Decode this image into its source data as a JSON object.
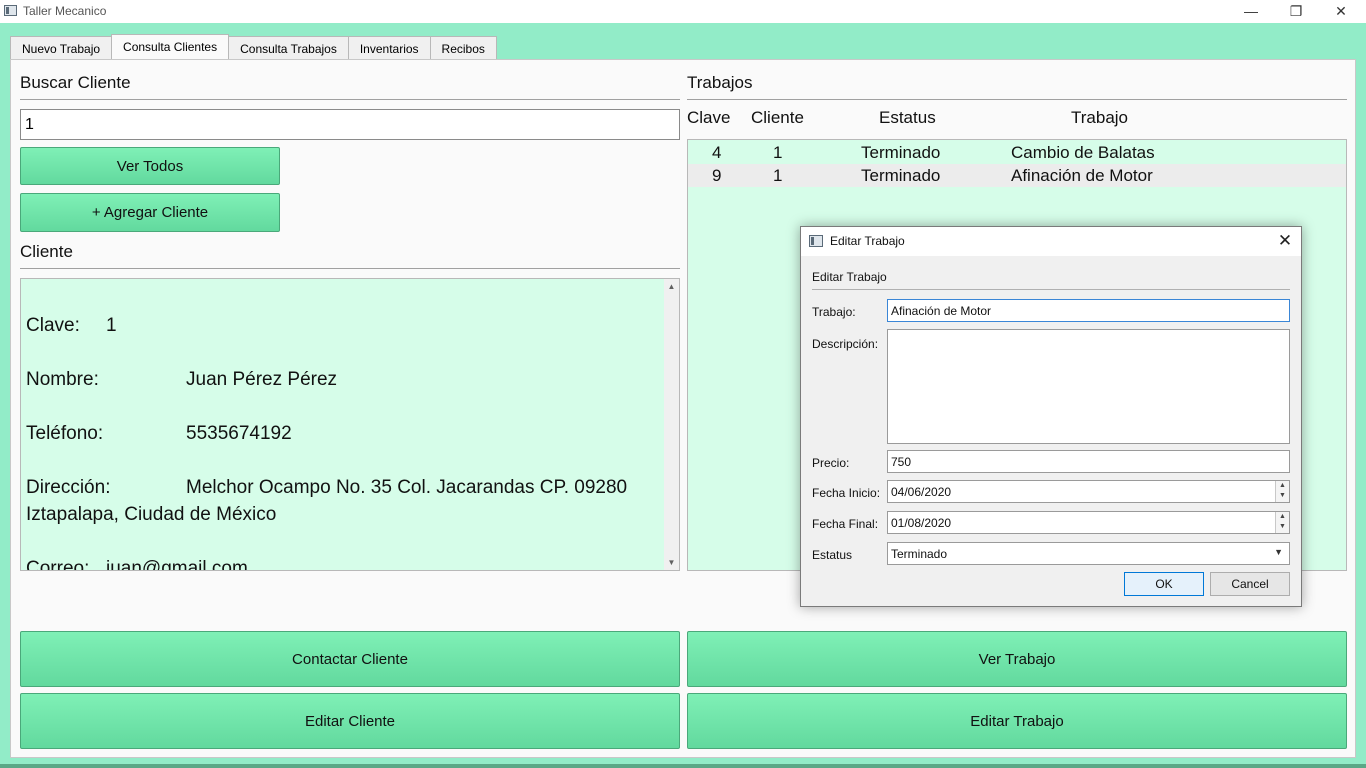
{
  "window": {
    "title": "Taller Mecanico",
    "minimize": "—",
    "maximize": "❐",
    "close": "✕"
  },
  "tabs": [
    {
      "label": "Nuevo Trabajo"
    },
    {
      "label": "Consulta Clientes"
    },
    {
      "label": "Consulta Trabajos"
    },
    {
      "label": "Inventarios"
    },
    {
      "label": "Recibos"
    }
  ],
  "search": {
    "title": "Buscar Cliente",
    "value": "1"
  },
  "buttons": {
    "ver_todos": "Ver Todos",
    "agregar_cliente": "+ Agregar Cliente",
    "contactar_cliente": "Contactar Cliente",
    "ver_trabajo": "Ver Trabajo",
    "editar_cliente": "Editar Cliente",
    "editar_trabajo": "Editar Trabajo"
  },
  "client": {
    "title": "Cliente",
    "clave_label": "Clave:",
    "clave": "1",
    "nombre_label": "Nombre:",
    "nombre": "Juan Pérez Pérez",
    "telefono_label": "Teléfono:",
    "telefono": "5535674192",
    "direccion_label": "Dirección:",
    "direccion_1": "Melchor Ocampo No. 35 Col. Jacarandas CP. 09280",
    "direccion_2": "Iztapalapa, Ciudad de México",
    "correo_label": "Correo:",
    "correo": "juan@gmail.com"
  },
  "jobs": {
    "title": "Trabajos",
    "columns": [
      "Clave",
      "Cliente",
      "Estatus",
      "Trabajo"
    ],
    "rows": [
      {
        "clave": "4",
        "cliente": "1",
        "estatus": "Terminado",
        "trabajo": "Cambio de Balatas"
      },
      {
        "clave": "9",
        "cliente": "1",
        "estatus": "Terminado",
        "trabajo": "Afinación de Motor"
      }
    ]
  },
  "dialog": {
    "title": "Editar Trabajo",
    "heading": "Editar Trabajo",
    "trabajo_label": "Trabajo:",
    "trabajo": "Afinación de Motor",
    "descripcion_label": "Descripción:",
    "descripcion": "",
    "precio_label": "Precio:",
    "precio": "750",
    "fecha_inicio_label": "Fecha Inicio:",
    "fecha_inicio": "04/06/2020",
    "fecha_final_label": "Fecha Final:",
    "fecha_final": "01/08/2020",
    "estatus_label": "Estatus",
    "estatus": "Terminado",
    "ok": "OK",
    "cancel": "Cancel"
  }
}
